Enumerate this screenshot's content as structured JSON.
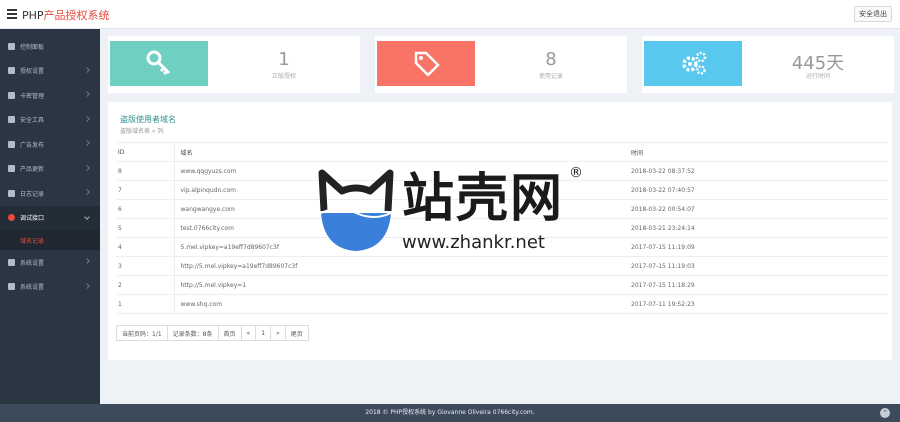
{
  "header": {
    "title_prefix": "PHP",
    "title_accent": "产品授权系统",
    "logout_label": "安全退出"
  },
  "sidebar": {
    "items": [
      {
        "label": "控制面板"
      },
      {
        "label": "授权设置"
      },
      {
        "label": "卡密管理"
      },
      {
        "label": "安全工具"
      },
      {
        "label": "广告发布"
      },
      {
        "label": "产品更新"
      },
      {
        "label": "日志记录"
      },
      {
        "label": "调试接口"
      },
      {
        "label": "系统设置"
      },
      {
        "label": "系统设置"
      }
    ],
    "active_sub": "域名记录"
  },
  "stats": [
    {
      "value": "1",
      "label": "正版授权",
      "color": "#6fcfc0",
      "icon": "key-icon"
    },
    {
      "value": "8",
      "label": "使用记录",
      "color": "#f87467",
      "icon": "tag-icon"
    },
    {
      "value": "445天",
      "label": "运行时间",
      "color": "#59c8ee",
      "icon": "gears-icon"
    }
  ],
  "panel": {
    "title": "盗版使用者域名",
    "subtitle": "盗版域名表 » 列"
  },
  "table": {
    "headers": [
      "ID",
      "域名",
      "时间"
    ],
    "rows": [
      [
        "8",
        "www.qqgyuzs.com",
        "2018-03-22 08:37:52"
      ],
      [
        "7",
        "vip.alpinqudn.com",
        "2018-03-22 07:40:57"
      ],
      [
        "6",
        "wangwangye.com",
        "2018-03-22 00:54:07"
      ],
      [
        "5",
        "test.0766city.com",
        "2018-03-21 23:24:14"
      ],
      [
        "4",
        "5.mel.vipkey=a19eff7d89607c3f",
        "2017-07-15 11:19:09"
      ],
      [
        "3",
        "http://5.mel.vipkey=a19eff7d89607c3f",
        "2017-07-15 11:19:03"
      ],
      [
        "2",
        "http://5.mel.vipkey=1",
        "2017-07-15 11:18:29"
      ],
      [
        "1",
        "www.shq.com",
        "2017-07-11 19:52:23"
      ]
    ]
  },
  "pager": {
    "page_info": "当前页码：1/1",
    "record_count": "记录条数：8条",
    "first": "首页",
    "prev": "«",
    "current": "1",
    "next": "»",
    "last": "尾页"
  },
  "watermark": {
    "brand_cn": "站壳网",
    "reg": "®",
    "url": "www.zhankr.net",
    "blue": "#3a7fd9"
  },
  "footer": {
    "text": "2018 © PHP授权系统 by Giovanne Oliveira 0766city.com."
  }
}
